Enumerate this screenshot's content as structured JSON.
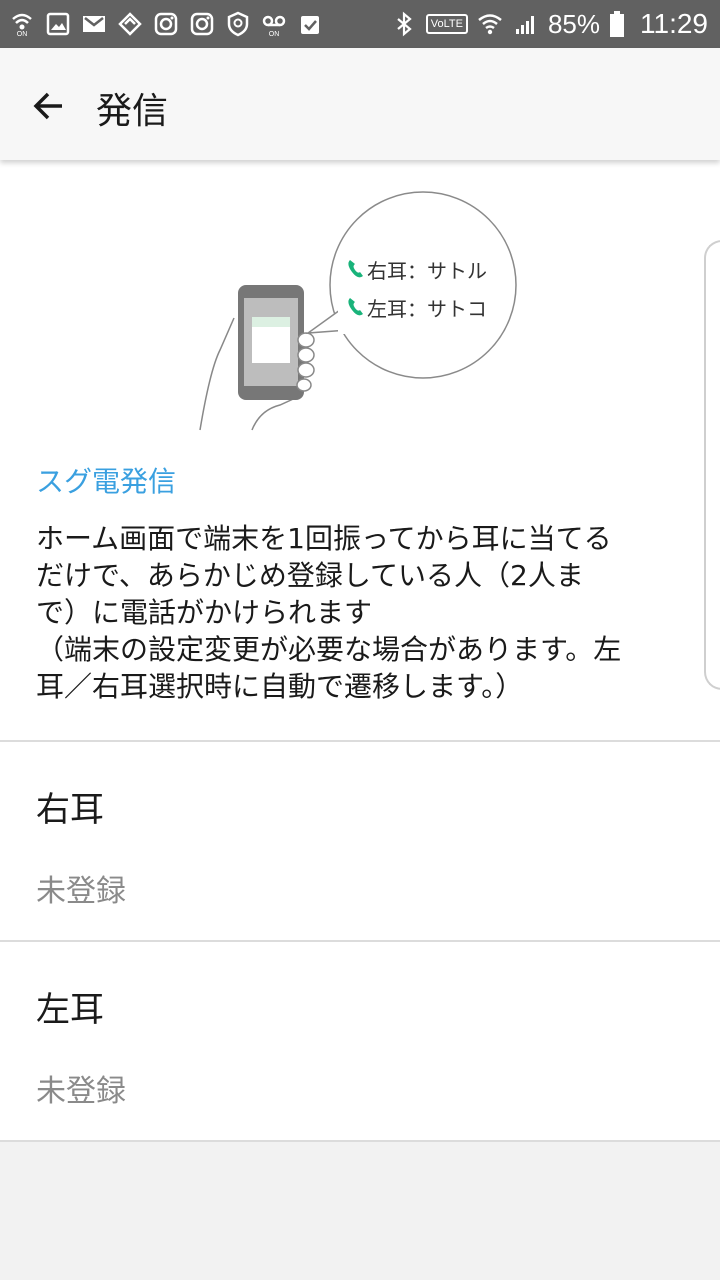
{
  "status_bar": {
    "battery_percent": "85%",
    "time": "11:29",
    "volte_label": "VoLTE",
    "icons": [
      "wifi-calling-icon",
      "gallery-icon",
      "gmail-icon",
      "app-icon",
      "instagram-icon",
      "instagram-icon",
      "shield-icon",
      "voicemail-icon",
      "clipboard-check-icon",
      "bluetooth-icon",
      "volte-icon",
      "wifi-icon",
      "signal-icon",
      "battery-icon"
    ]
  },
  "appbar": {
    "title": "発信"
  },
  "illustration": {
    "bubble_line1": "右耳：サトル",
    "bubble_line2": "左耳：サトコ",
    "accent_color": "#19b37a"
  },
  "feature": {
    "title": "スグ電発信",
    "description_lines": [
      "ホーム画面で端末を1回振ってから耳に当てる",
      "だけで、あらかじめ登録している人（2人ま",
      "で）に電話がかけられます",
      "（端末の設定変更が必要な場合があります。左",
      "耳／右耳選択時に自動で遷移します。）"
    ]
  },
  "settings": {
    "right_ear": {
      "label": "右耳",
      "value": "未登録"
    },
    "left_ear": {
      "label": "左耳",
      "value": "未登録"
    }
  },
  "colors": {
    "accent_blue": "#3aa0e0",
    "status_bar": "#616161"
  }
}
